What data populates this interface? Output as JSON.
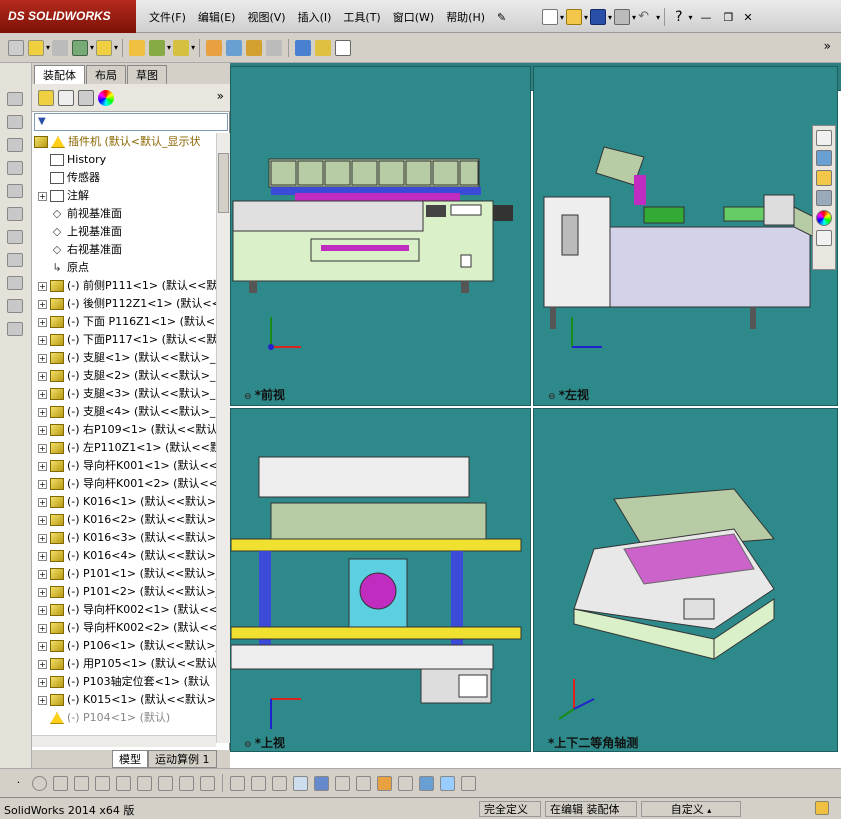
{
  "app": {
    "logo_text": "SOLIDWORKS",
    "logo_mark": "DS"
  },
  "menu": [
    "文件(F)",
    "编辑(E)",
    "视图(V)",
    "插入(I)",
    "工具(T)",
    "窗口(W)",
    "帮助(H)"
  ],
  "window_controls": {
    "help": "?",
    "minimize": "—",
    "restore": "❐",
    "close": "✕"
  },
  "fm_tabs": [
    "装配体",
    "布局",
    "草图"
  ],
  "fm_filter_icon": "filter-icon",
  "tree": {
    "root": "插件机 (默认<默认_显示状",
    "items": [
      {
        "label": "History",
        "icon": "history-icon",
        "expand": false
      },
      {
        "label": "传感器",
        "icon": "sensor-icon",
        "expand": false
      },
      {
        "label": "注解",
        "icon": "annotation-icon",
        "expand": true
      },
      {
        "label": "前视基准面",
        "icon": "plane-icon",
        "expand": false
      },
      {
        "label": "上视基准面",
        "icon": "plane-icon",
        "expand": false
      },
      {
        "label": "右视基准面",
        "icon": "plane-icon",
        "expand": false
      },
      {
        "label": "原点",
        "icon": "origin-icon",
        "expand": false
      },
      {
        "label": "(-) 前侧P111<1> (默认<<默",
        "icon": "part-icon",
        "expand": true
      },
      {
        "label": "(-) 後侧P112Z1<1> (默认<<",
        "icon": "part-icon",
        "expand": true
      },
      {
        "label": "(-) 下面 P116Z1<1> (默认<",
        "icon": "part-icon",
        "expand": true
      },
      {
        "label": "(-) 下面P117<1> (默认<<默",
        "icon": "part-icon",
        "expand": true
      },
      {
        "label": "(-) 支腿<1> (默认<<默认>_",
        "icon": "part-icon",
        "expand": true
      },
      {
        "label": "(-) 支腿<2> (默认<<默认>_",
        "icon": "part-icon",
        "expand": true
      },
      {
        "label": "(-) 支腿<3> (默认<<默认>_",
        "icon": "part-icon",
        "expand": true
      },
      {
        "label": "(-) 支腿<4> (默认<<默认>_",
        "icon": "part-icon",
        "expand": true
      },
      {
        "label": "(-) 右P109<1> (默认<<默认",
        "icon": "part-icon",
        "expand": true
      },
      {
        "label": "(-) 左P110Z1<1> (默认<<默",
        "icon": "part-icon",
        "expand": true
      },
      {
        "label": "(-) 导向杆K001<1> (默认<<",
        "icon": "part-icon",
        "expand": true
      },
      {
        "label": "(-) 导向杆K001<2> (默认<<",
        "icon": "part-icon",
        "expand": true
      },
      {
        "label": "(-) K016<1> (默认<<默认>_",
        "icon": "part-icon",
        "expand": true
      },
      {
        "label": "(-) K016<2> (默认<<默认>_",
        "icon": "part-icon",
        "expand": true
      },
      {
        "label": "(-) K016<3> (默认<<默认>_",
        "icon": "part-icon",
        "expand": true
      },
      {
        "label": "(-) K016<4> (默认<<默认>_",
        "icon": "part-icon",
        "expand": true
      },
      {
        "label": "(-) P101<1> (默认<<默认>_",
        "icon": "part-icon",
        "expand": true
      },
      {
        "label": "(-) P101<2> (默认<<默认>_",
        "icon": "part-icon",
        "expand": true
      },
      {
        "label": "(-) 导向杆K002<1> (默认<<",
        "icon": "part-icon",
        "expand": true
      },
      {
        "label": "(-) 导向杆K002<2> (默认<<",
        "icon": "part-icon",
        "expand": true
      },
      {
        "label": "(-) P106<1> (默认<<默认>_",
        "icon": "part-icon",
        "expand": true
      },
      {
        "label": "(-) 用P105<1> (默认<<默认",
        "icon": "part-icon",
        "expand": true
      },
      {
        "label": "(-) P103轴定位套<1> (默认",
        "icon": "part-icon",
        "expand": true
      },
      {
        "label": "(-) K015<1> (默认<<默认>_",
        "icon": "part-icon",
        "expand": true
      },
      {
        "label": "(-) P104<1> (默认)",
        "icon": "warning-icon",
        "expand": false
      }
    ]
  },
  "bottom_tabs": [
    "模型",
    "运动算例 1"
  ],
  "views": [
    {
      "label": "*前视"
    },
    {
      "label": "*左视"
    },
    {
      "label": "*上视"
    },
    {
      "label": "*上下二等角轴测"
    }
  ],
  "axis_labels": {
    "x": "X",
    "y": "Y",
    "z": "Z"
  },
  "status": {
    "version": "SolidWorks 2014 x64 版",
    "defined": "完全定义",
    "editing": "在编辑 装配体",
    "units": "自定义"
  },
  "colors": {
    "viewport_bg": "#2e8a8a",
    "machine_body": "#d9f0c8",
    "tray_green": "#b7cca5",
    "magenta": "#c02bc0",
    "blue_frame": "#3b4bd8",
    "yellow_rail": "#f0e030"
  }
}
